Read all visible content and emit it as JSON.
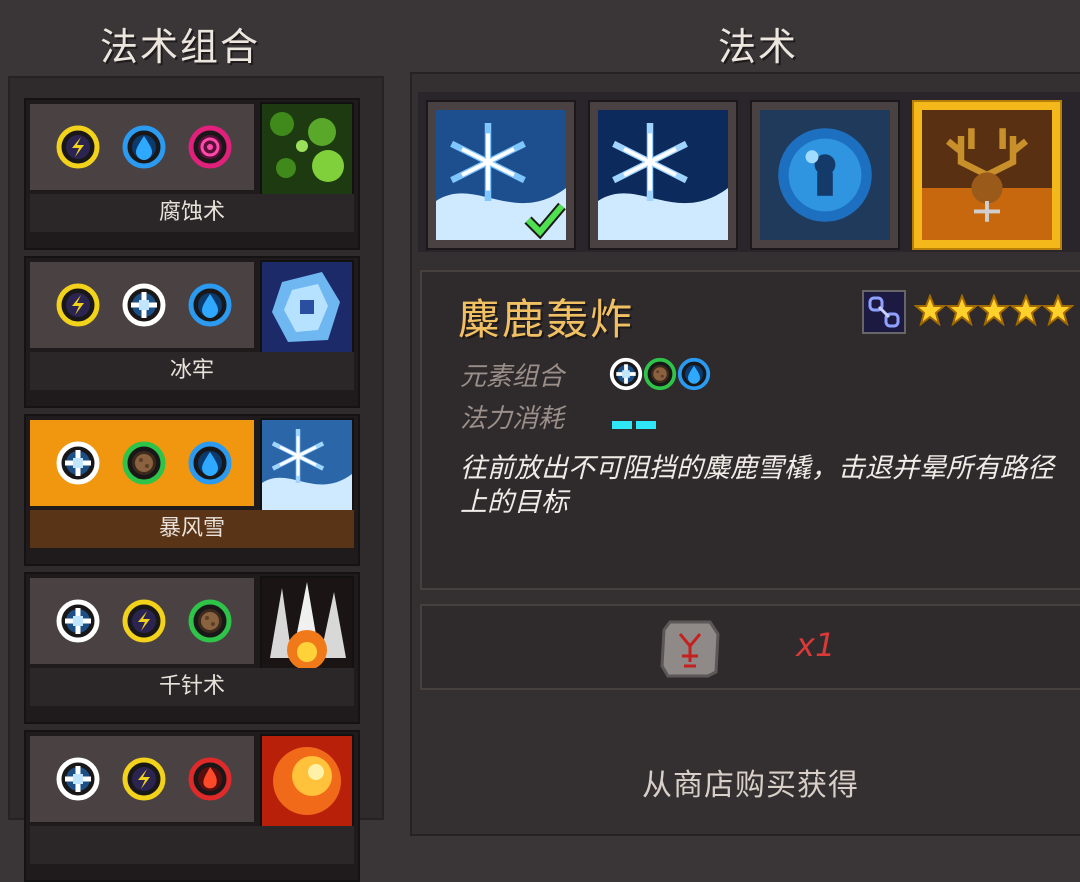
{
  "headers": {
    "left_title": "法术组合",
    "right_title": "法术"
  },
  "combos": [
    {
      "label": "腐蚀术",
      "elements": [
        "lightning",
        "water",
        "poison"
      ],
      "thumb": "acid-thumb",
      "selected": false
    },
    {
      "label": "冰牢",
      "elements": [
        "lightning",
        "ice",
        "water"
      ],
      "thumb": "ice-prison-thumb",
      "selected": false
    },
    {
      "label": "暴风雪",
      "elements": [
        "ice",
        "earth",
        "water"
      ],
      "thumb": "blizzard-thumb",
      "selected": true
    },
    {
      "label": "千针术",
      "elements": [
        "ice",
        "lightning",
        "earth"
      ],
      "thumb": "spikes-thumb",
      "selected": false
    },
    {
      "label": "",
      "elements": [
        "ice",
        "lightning",
        "fire"
      ],
      "thumb": "fire-thumb",
      "selected": false
    }
  ],
  "spells": [
    {
      "icon": "snowflake-swirl",
      "owned": true,
      "selected": false
    },
    {
      "icon": "snowflake-swirl-dark",
      "owned": false,
      "selected": false
    },
    {
      "icon": "water-orb",
      "owned": false,
      "selected": false
    },
    {
      "icon": "elk-antlers",
      "owned": false,
      "selected": true
    }
  ],
  "detail": {
    "name": "麋鹿轰炸",
    "stars": 5,
    "elements_label": "元素组合",
    "elements": [
      "ice",
      "earth",
      "water"
    ],
    "mana_label": "法力消耗",
    "mana_cost": 2,
    "description": "往前放出不可阻挡的麋鹿雪橇，击退并晕所有路径上的目标",
    "cost_item": "elk-rune-stone",
    "cost_count": "x1",
    "source": "从商店购买获得"
  },
  "colors": {
    "accent": "#f4b81a",
    "selected_combo": "#f0960f",
    "title_gold": "#f1c062",
    "mana": "#2ee6f5",
    "cost_red": "#d83a3a"
  }
}
